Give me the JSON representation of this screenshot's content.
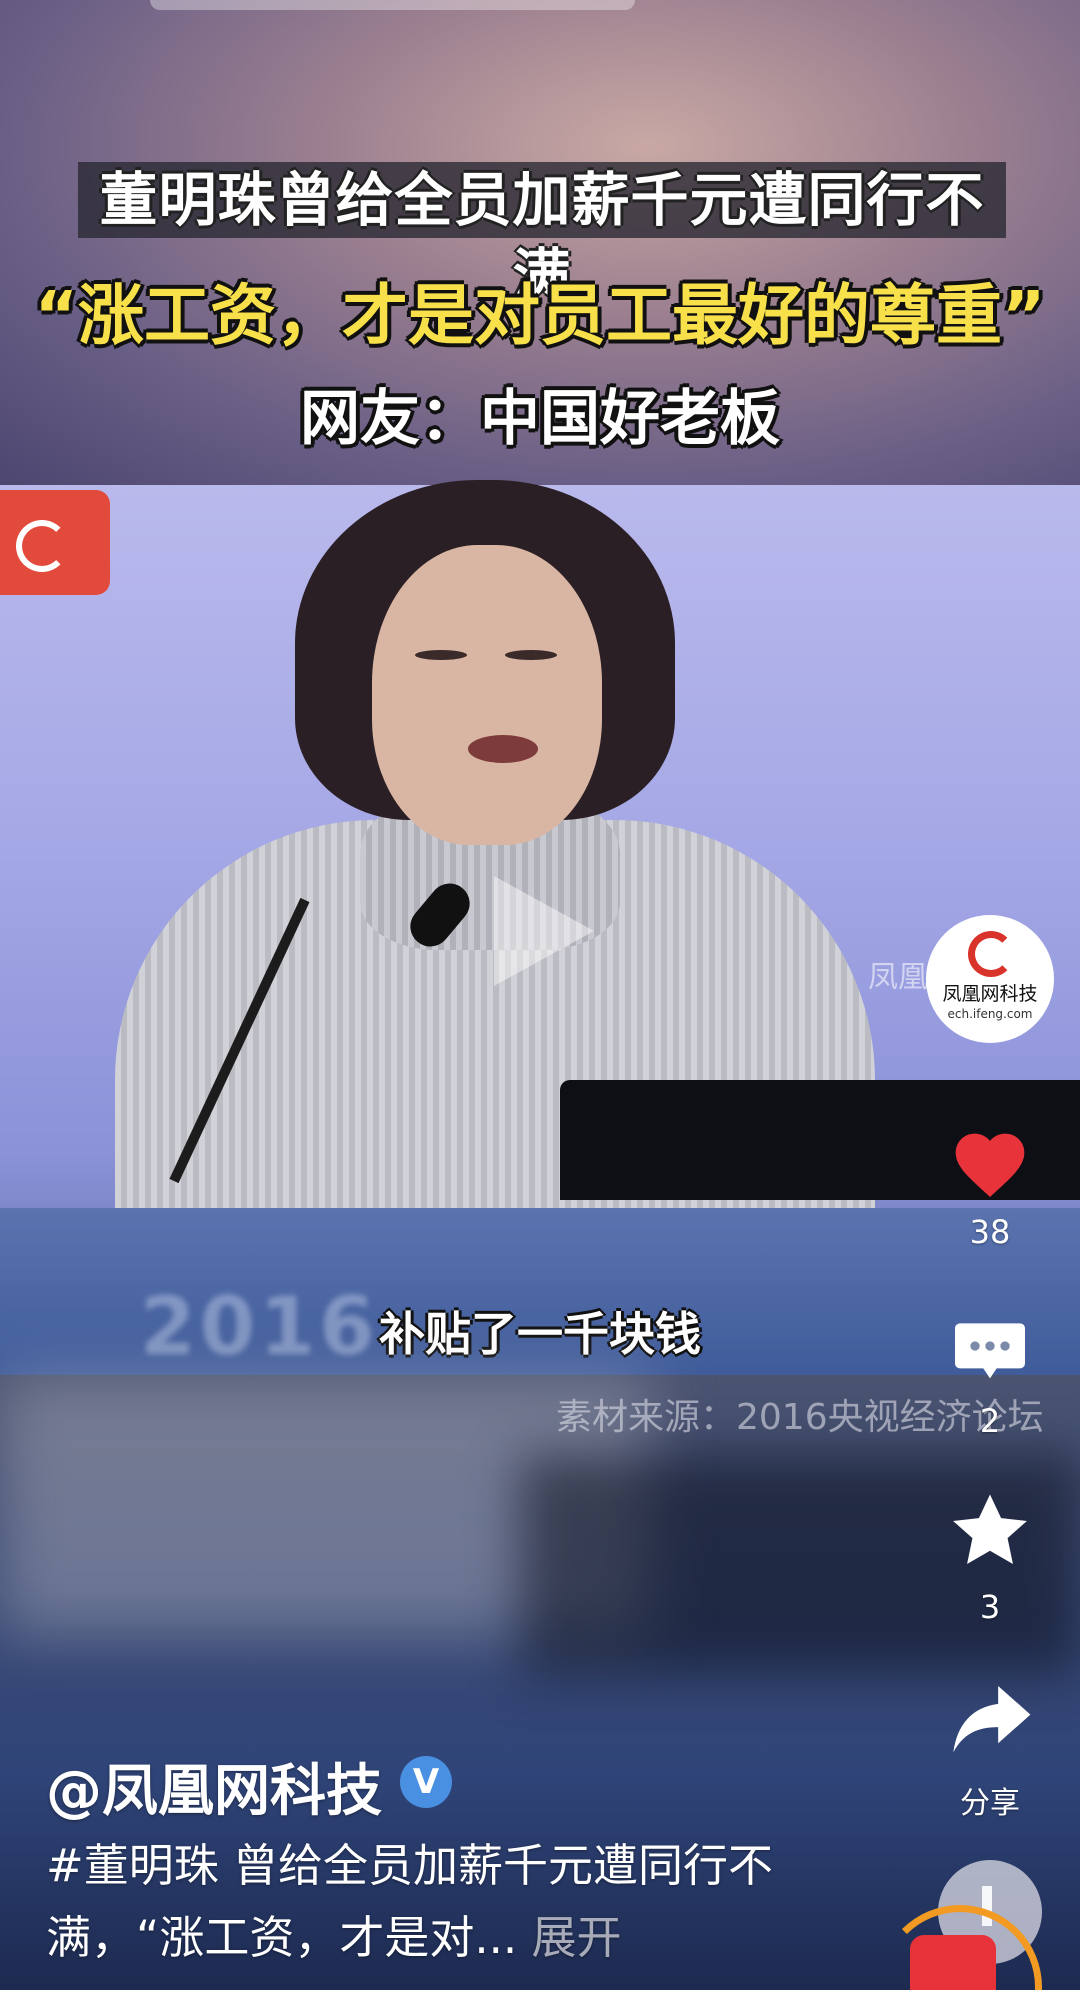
{
  "overlay": {
    "headline": "董明珠曾给全员加薪千元遭同行不满",
    "quote": "“涨工资，才是对员工最好的尊重”",
    "sub_quote": "网友：中国好老板"
  },
  "video": {
    "subtitle": "补贴了一千块钱",
    "source": "素材来源：2016央视经济论坛",
    "watermark": "凤凰",
    "podium_text": "2016"
  },
  "rail": {
    "avatar_name": "凤凰网科技",
    "avatar_url": "ech.ifeng.com",
    "likes": "38",
    "comments": "2",
    "favorites": "3",
    "share_label": "分享"
  },
  "post": {
    "author": "@凤凰网科技",
    "verified_mark": "V",
    "description": "#董明珠 曾给全员加薪千元遭同行不满，“涨工资，才是对...",
    "expand_label": "展开"
  },
  "colors": {
    "like_red": "#e8333a",
    "accent_yellow": "#f7e04a",
    "verified_blue": "#4a90e2",
    "progress_orange": "#f29a22"
  },
  "icons": [
    "heart-icon",
    "comment-icon",
    "star-icon",
    "share-icon",
    "play-icon",
    "verified-icon",
    "music-disc-icon"
  ]
}
